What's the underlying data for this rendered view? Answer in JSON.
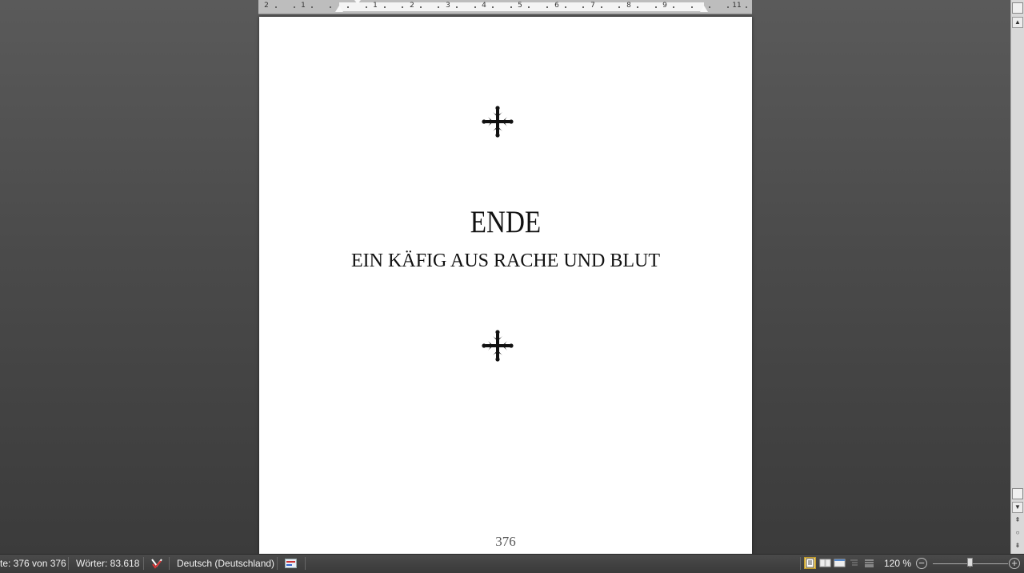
{
  "ruler": {
    "numbers": [
      "2",
      "1",
      "1",
      "2",
      "3",
      "4",
      "5",
      "6",
      "7",
      "8",
      "9",
      "11"
    ]
  },
  "document": {
    "title": "ENDE",
    "subtitle": "EIN KÄFIG AUS RACHE UND BLUT",
    "page_number": "376",
    "ornament_icon": "cross-fleury-ornament"
  },
  "statusbar": {
    "page_info": "te: 376 von 376",
    "word_count": "Wörter: 83.618",
    "language": "Deutsch (Deutschland)",
    "zoom_level": "120 %",
    "zoom_minus": "−",
    "zoom_plus": "+",
    "active_view": "print-layout"
  },
  "colors": {
    "background": "#4a4a4a",
    "page": "#ffffff",
    "statusbar": "#3d3d3d",
    "active_view": "#f7d56a"
  }
}
